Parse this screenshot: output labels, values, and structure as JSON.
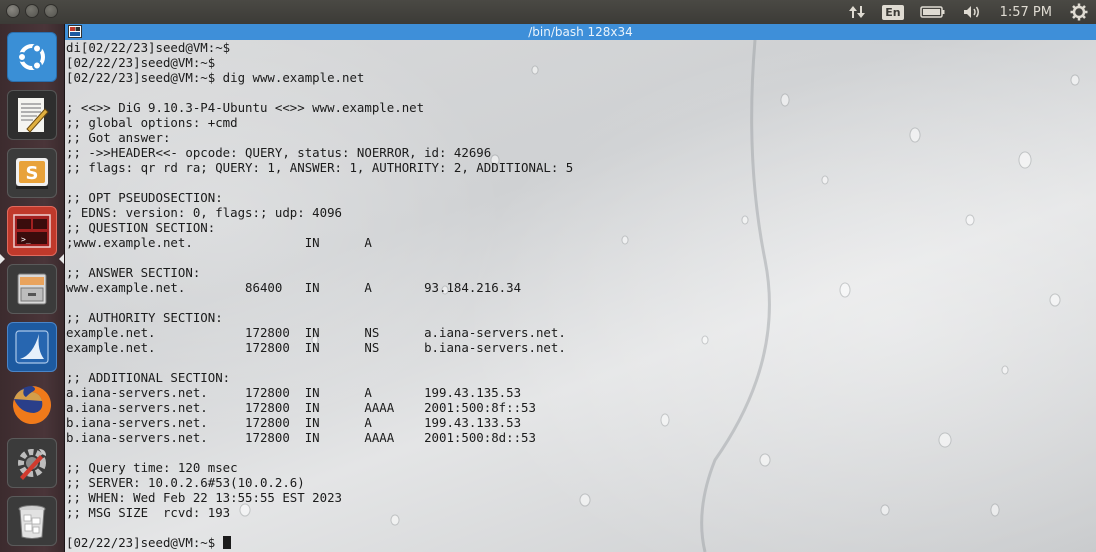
{
  "topbar": {
    "language": "En",
    "clock": "1:57 PM",
    "icons": [
      "network-updown-icon",
      "battery-icon",
      "volume-icon",
      "settings-gear-icon"
    ]
  },
  "launcher": {
    "items": [
      {
        "name": "ubuntu-dash",
        "icon": "ubuntu-logo-icon"
      },
      {
        "name": "text-editor",
        "icon": "text-editor-icon"
      },
      {
        "name": "sublime-text",
        "icon": "sublime-text-icon"
      },
      {
        "name": "terminal",
        "icon": "terminal-icon",
        "active": true
      },
      {
        "name": "file-manager",
        "icon": "file-cabinet-icon"
      },
      {
        "name": "wireshark",
        "icon": "wireshark-fin-icon"
      },
      {
        "name": "firefox",
        "icon": "firefox-icon"
      },
      {
        "name": "system-settings",
        "icon": "settings-tools-icon"
      },
      {
        "name": "trash",
        "icon": "trash-icon"
      }
    ]
  },
  "terminal": {
    "title": "/bin/bash 128x34",
    "lines": [
      "di[02/22/23]seed@VM:~$",
      "[02/22/23]seed@VM:~$",
      "[02/22/23]seed@VM:~$ dig www.example.net",
      "",
      "; <<>> DiG 9.10.3-P4-Ubuntu <<>> www.example.net",
      ";; global options: +cmd",
      ";; Got answer:",
      ";; ->>HEADER<<- opcode: QUERY, status: NOERROR, id: 42696",
      ";; flags: qr rd ra; QUERY: 1, ANSWER: 1, AUTHORITY: 2, ADDITIONAL: 5",
      "",
      ";; OPT PSEUDOSECTION:",
      "; EDNS: version: 0, flags:; udp: 4096",
      ";; QUESTION SECTION:",
      ";www.example.net.               IN      A",
      "",
      ";; ANSWER SECTION:",
      "www.example.net.        86400   IN      A       93.184.216.34",
      "",
      ";; AUTHORITY SECTION:",
      "example.net.            172800  IN      NS      a.iana-servers.net.",
      "example.net.            172800  IN      NS      b.iana-servers.net.",
      "",
      ";; ADDITIONAL SECTION:",
      "a.iana-servers.net.     172800  IN      A       199.43.135.53",
      "a.iana-servers.net.     172800  IN      AAAA    2001:500:8f::53",
      "b.iana-servers.net.     172800  IN      A       199.43.133.53",
      "b.iana-servers.net.     172800  IN      AAAA    2001:500:8d::53",
      "",
      ";; Query time: 120 msec",
      ";; SERVER: 10.0.2.6#53(10.0.2.6)",
      ";; WHEN: Wed Feb 22 13:55:55 EST 2023",
      ";; MSG SIZE  rcvd: 193",
      "",
      "[02/22/23]seed@VM:~$ "
    ]
  }
}
